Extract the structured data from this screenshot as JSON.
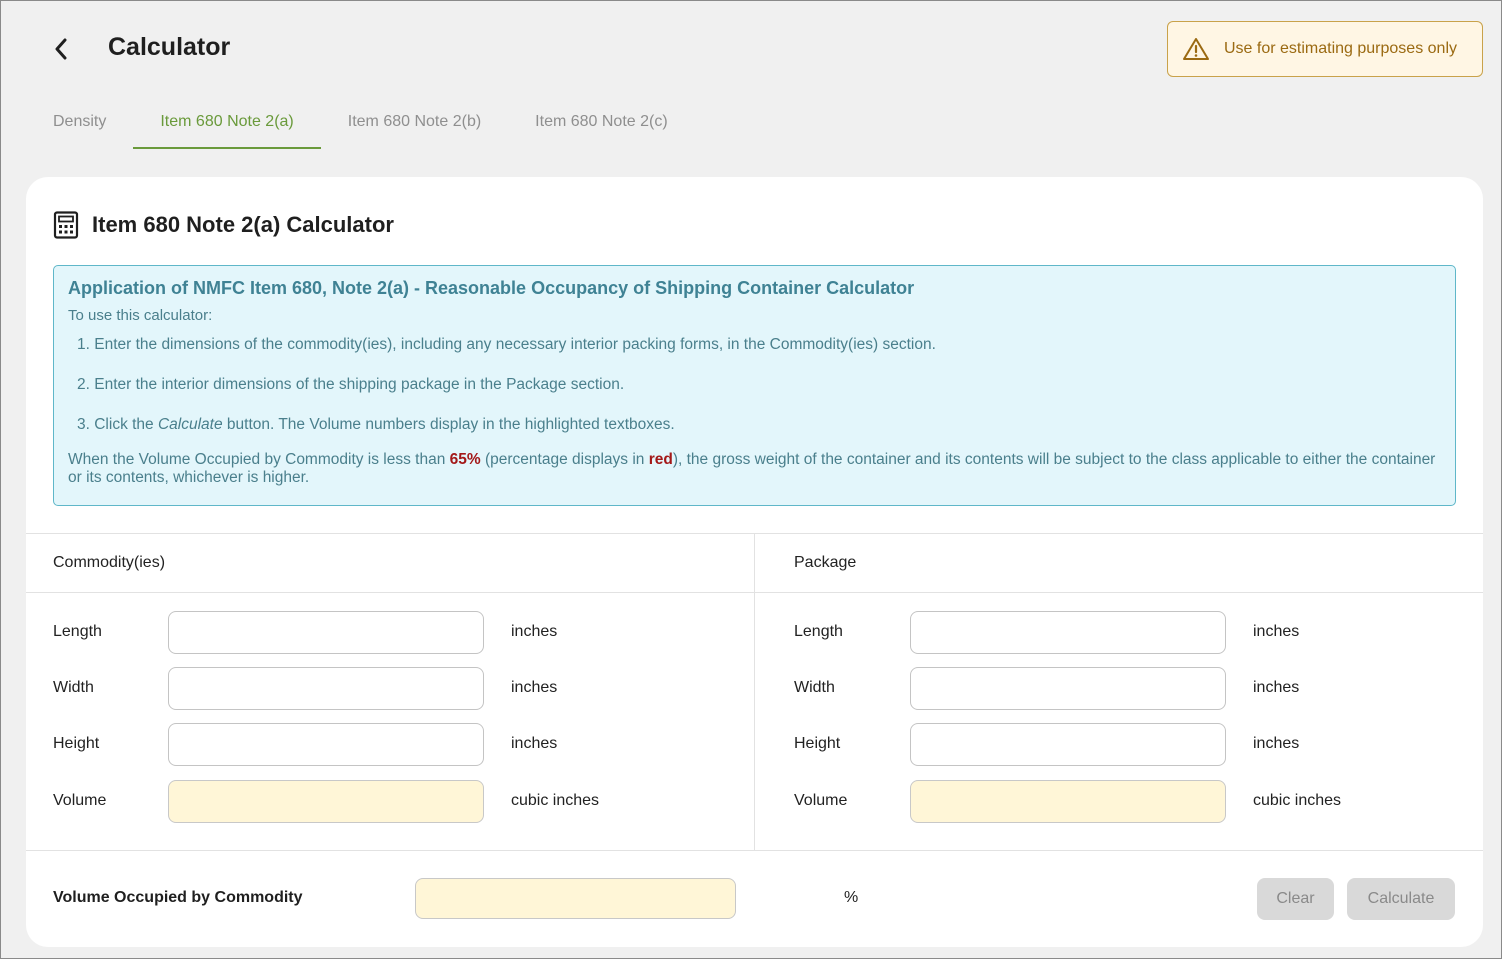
{
  "header": {
    "title": "Calculator",
    "warning": "Use for estimating purposes only"
  },
  "tabs": [
    {
      "label": "Density",
      "active": false
    },
    {
      "label": "Item 680 Note 2(a)",
      "active": true
    },
    {
      "label": "Item 680 Note 2(b)",
      "active": false
    },
    {
      "label": "Item 680 Note 2(c)",
      "active": false
    }
  ],
  "card": {
    "title": "Item 680 Note 2(a) Calculator",
    "info": {
      "title": "Application of NMFC Item 680, Note 2(a) - Reasonable Occupancy of Shipping Container Calculator",
      "intro": "To use this calculator:",
      "step1": "1. Enter the dimensions of the commodity(ies), including any necessary interior packing forms, in the Commodity(ies) section.",
      "step2": "2. Enter the interior dimensions of the shipping package in the Package section.",
      "step3_pre": "3. Click the ",
      "step3_em": "Calculate",
      "step3_post": " button. The Volume numbers display in the highlighted textboxes.",
      "note_pre": "When the Volume Occupied by Commodity is less than ",
      "note_pct": "65%",
      "note_mid": " (percentage displays in ",
      "note_red": "red",
      "note_post": "), the gross weight of the container and its contents will be subject to the class applicable to either the container or its contents, whichever is higher."
    },
    "commodity": {
      "heading": "Commodity(ies)",
      "length_label": "Length",
      "length_value": "",
      "length_unit": "inches",
      "width_label": "Width",
      "width_value": "",
      "width_unit": "inches",
      "height_label": "Height",
      "height_value": "",
      "height_unit": "inches",
      "volume_label": "Volume",
      "volume_value": "",
      "volume_unit": "cubic inches"
    },
    "package": {
      "heading": "Package",
      "length_label": "Length",
      "length_value": "",
      "length_unit": "inches",
      "width_label": "Width",
      "width_value": "",
      "width_unit": "inches",
      "height_label": "Height",
      "height_value": "",
      "height_unit": "inches",
      "volume_label": "Volume",
      "volume_value": "",
      "volume_unit": "cubic inches"
    },
    "occupied": {
      "label": "Volume Occupied by Commodity",
      "value": "",
      "unit": "%"
    },
    "buttons": {
      "clear": "Clear",
      "calculate": "Calculate"
    }
  },
  "colors": {
    "accent": "#6a9a3b",
    "warning_border": "#c9a24a",
    "info_bg": "#e3f6fb",
    "highlight_field": "#fff6d7",
    "alert_red": "#a31818"
  },
  "icons": {
    "back": "chevron-left-icon",
    "warning": "warning-triangle-icon",
    "calculator": "calculator-icon"
  }
}
